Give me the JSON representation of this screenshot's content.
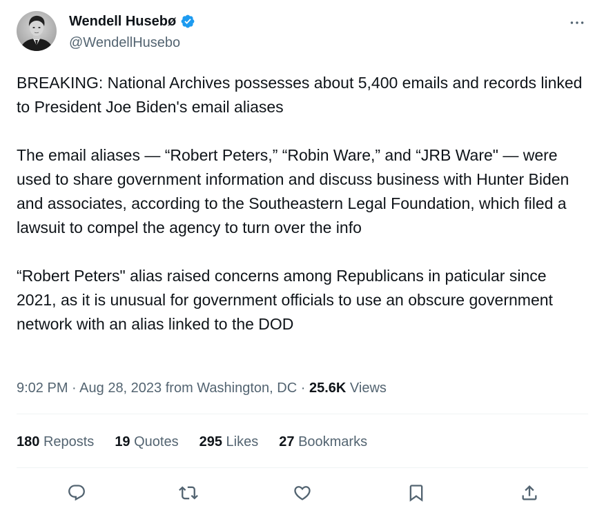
{
  "author": {
    "display_name": "Wendell Husebø",
    "handle": "@WendellHusebo",
    "verified": true
  },
  "tweet": {
    "paragraphs": [
      "BREAKING: National Archives possesses about 5,400 emails and records linked to President Joe Biden's email aliases",
      "The email aliases — “Robert Peters,” “Robin Ware,” and “JRB Ware\" — were used to share government information and discuss business with Hunter Biden and associates, according to the Southeastern Legal Foundation, which filed a lawsuit to compel the agency to turn over the info",
      "“Robert Peters\" alias raised concerns among Republicans in paticular since 2021, as it is unusual for government officials to use an obscure government network with an alias linked to the DOD"
    ],
    "time": "9:02 PM",
    "date": "Aug 28, 2023",
    "location": "from Washington, DC",
    "separator": "·",
    "views_count": "25.6K",
    "views_label": "Views"
  },
  "stats": [
    {
      "count": "180",
      "label": "Reposts"
    },
    {
      "count": "19",
      "label": "Quotes"
    },
    {
      "count": "295",
      "label": "Likes"
    },
    {
      "count": "27",
      "label": "Bookmarks"
    }
  ],
  "actions": [
    "reply-icon",
    "repost-icon",
    "like-icon",
    "bookmark-icon",
    "share-icon"
  ],
  "colors": {
    "text": "#0f1419",
    "secondary": "#536471",
    "verified": "#1d9bf0",
    "divider": "#eff3f4"
  }
}
